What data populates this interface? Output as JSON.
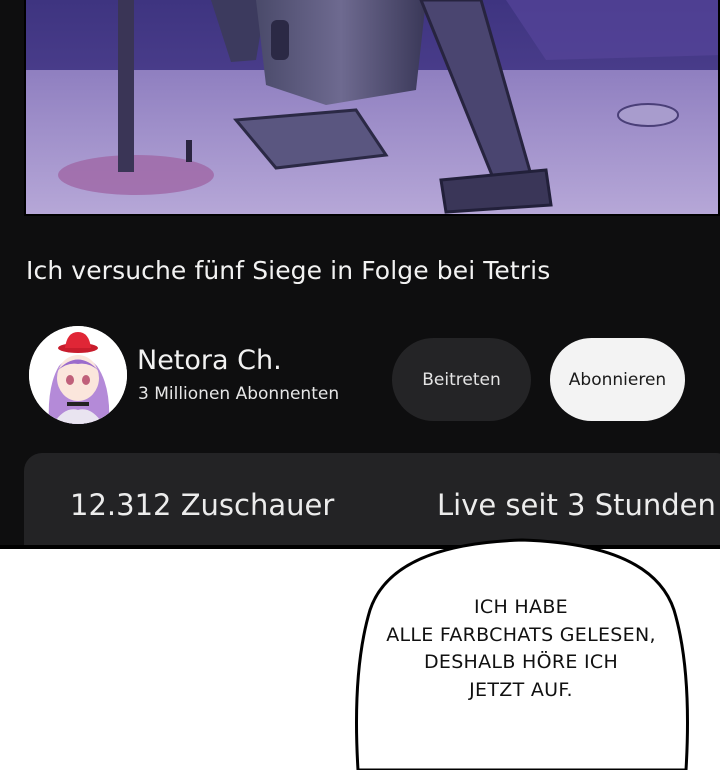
{
  "video": {
    "title": "Ich versuche fünf Siege in Folge bei Tetris",
    "scene": "gaming-desk-illustration"
  },
  "channel": {
    "name": "Netora Ch.",
    "subscribers": "3 Millionen Abonnenten",
    "join_label": "Beitreten",
    "subscribe_label": "Abonnieren"
  },
  "stats": {
    "viewers": "12.312 Zuschauer",
    "live_since": "Live seit 3 Stunden"
  },
  "speech_bubble": {
    "lines": [
      "ICH HABE",
      "ALLE FARBCHATS GELESEN,",
      "DESHALB HÖRE ICH",
      "JETZT AUF."
    ]
  },
  "colors": {
    "app_background": "#0e0e0f",
    "card": "#232325",
    "join_button": "#242426",
    "subscribe_button": "#f3f3f3",
    "text": "#f2f2f2"
  }
}
